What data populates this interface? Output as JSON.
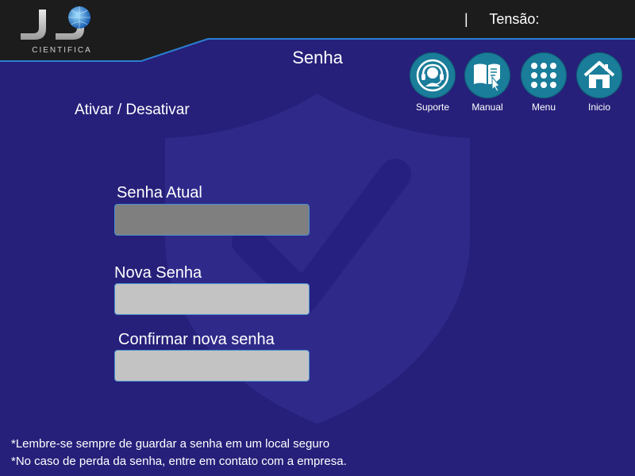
{
  "header": {
    "logo": {
      "monogram": "JJ",
      "subtitle": "CIENTIFICA"
    },
    "tension_separator": "|",
    "tension_label": "Tensão:",
    "tension_value": ""
  },
  "page": {
    "title": "Senha"
  },
  "nav": [
    {
      "id": "suporte",
      "label": "Suporte",
      "icon": "headset-icon"
    },
    {
      "id": "manual",
      "label": "Manual",
      "icon": "book-touch-icon"
    },
    {
      "id": "menu",
      "label": "Menu",
      "icon": "grid-dots-icon"
    },
    {
      "id": "inicio",
      "label": "Inicio",
      "icon": "home-icon"
    }
  ],
  "toggle": {
    "label": "Ativar / Desativar"
  },
  "background": {
    "watermark": "shield-check-icon"
  },
  "form": {
    "current_password": {
      "label": "Senha Atual",
      "value": "",
      "placeholder": ""
    },
    "new_password": {
      "label": "Nova Senha",
      "value": "",
      "placeholder": ""
    },
    "confirm_password": {
      "label": "Confirmar nova senha",
      "value": "",
      "placeholder": ""
    }
  },
  "notes": [
    "*Lembre-se sempre de guardar a senha em um local seguro",
    "*No caso de perda da senha, entre em contato com a empresa."
  ],
  "colors": {
    "background": "#26207a",
    "topbar": "#1c1c1c",
    "accent_line": "#2a7fd0",
    "nav_button": "#1a7d9a",
    "field_disabled": "#7f7f7f",
    "field": "#c3c3c3",
    "text": "#ffffff"
  }
}
